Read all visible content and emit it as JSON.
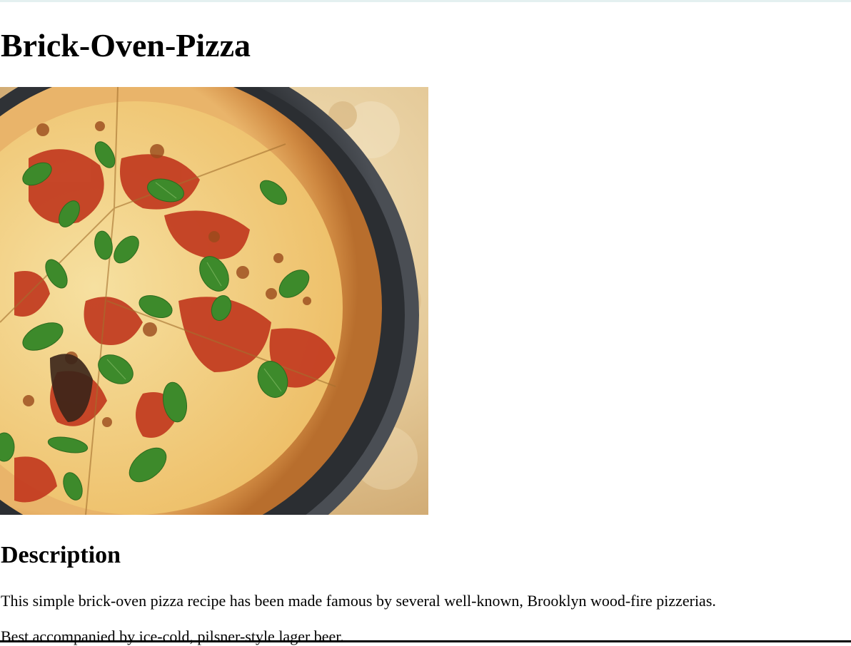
{
  "recipe": {
    "title": "Brick-Oven-Pizza",
    "image_icon": "pizza-photo",
    "section_heading": "Description",
    "description_line_1": "This simple brick-oven pizza recipe has been made famous by several well-known, Brooklyn wood-fire pizzerias.",
    "description_line_2": "Best accompanied by ice-cold, pilsner-style lager beer."
  },
  "colors": {
    "text": "#000000",
    "background": "#ffffff",
    "pan": "#3a3d42",
    "crust": "#d99a52",
    "sauce": "#c2341c",
    "cheese": "#f1d483",
    "basil": "#3f8a2c",
    "stone": "#e6cfa0"
  }
}
